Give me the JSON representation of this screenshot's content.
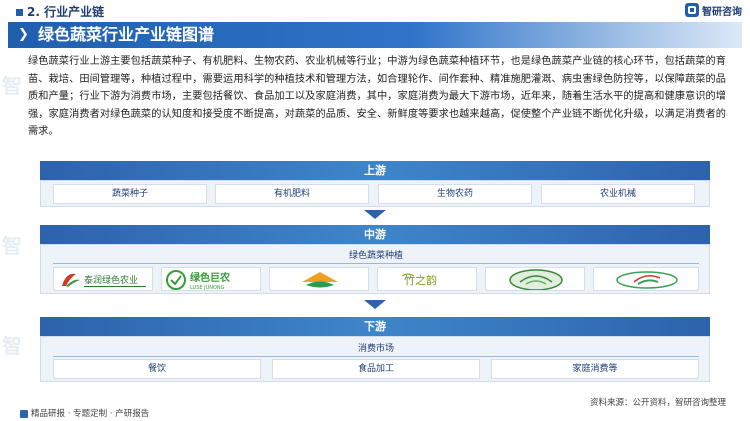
{
  "header": {
    "section_title": "2. 行业产业链",
    "logo_text": "智研咨询",
    "main_title": "绿色蔬菜行业产业链图谱"
  },
  "intro": "绿色蔬菜行业上游主要包括蔬菜种子、有机肥料、生物农药、农业机械等行业；中游为绿色蔬菜种植环节，也是绿色蔬菜产业链的核心环节，包括蔬菜的育苗、栽培、田间管理等，种植过程中，需要运用科学的种植技术和管理方法，如合理轮作、间作套种、精准施肥灌溉、病虫害绿色防控等，以保障蔬菜的品质和产量；行业下游为消费市场，主要包括餐饮、食品加工以及家庭消费，其中，家庭消费为最大下游市场，近年来，随着生活水平的提高和健康意识的增强，家庭消费者对绿色蔬菜的认知度和接受度不断提高，对蔬菜的品质、安全、新鲜度等要求也越来越高，促使整个产业链不断优化升级，以满足消费者的需求。",
  "chain": {
    "upstream": {
      "label": "上游",
      "items": [
        "蔬菜种子",
        "有机肥料",
        "生物农药",
        "农业机械"
      ]
    },
    "midstream": {
      "label": "中游",
      "sub_label": "绿色蔬菜种植",
      "logos": [
        {
          "name": "company-logo-1",
          "text": "泰润绿色农业"
        },
        {
          "name": "company-logo-2",
          "text": "绿色巨农",
          "subtext": "LUSE JUNONG"
        },
        {
          "name": "company-logo-3",
          "text": ""
        },
        {
          "name": "company-logo-4",
          "text": "竹之韵"
        },
        {
          "name": "company-logo-5",
          "text": ""
        },
        {
          "name": "company-logo-6",
          "text": ""
        }
      ]
    },
    "downstream": {
      "label": "下游",
      "sub_label": "消费市场",
      "items": [
        "餐饮",
        "食品加工",
        "家庭消费等"
      ]
    }
  },
  "footer": {
    "left": "精品研报 · 专题定制 · 产研报告",
    "right": "资料来源：公开资料，智研咨询整理"
  },
  "colors": {
    "primary": "#1f5fae",
    "tier": "#2d62ad",
    "panel": "#eef3fa"
  }
}
